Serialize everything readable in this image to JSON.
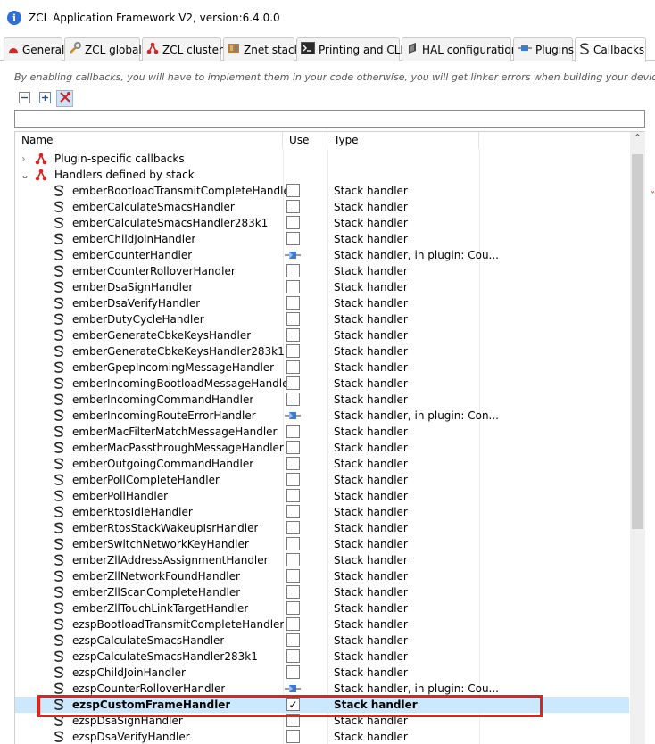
{
  "window": {
    "title": "ZCL Application Framework V2, version:6.4.0.0"
  },
  "tabs": [
    {
      "label": "General",
      "icon": "red-half-circle-icon"
    },
    {
      "label": "ZCL global",
      "icon": "wrench-icon"
    },
    {
      "label": "ZCL clusters",
      "icon": "cluster-nodes-icon"
    },
    {
      "label": "Znet stack",
      "icon": "stack-chip-icon"
    },
    {
      "label": "Printing and CLI",
      "icon": "terminal-icon"
    },
    {
      "label": "HAL configuration",
      "icon": "chip-icon"
    },
    {
      "label": "Plugins",
      "icon": "plugin-icon"
    },
    {
      "label": "Callbacks",
      "icon": "callback-icon",
      "active": true
    }
  ],
  "hint": "By enabling callbacks, you will have to implement them in your code otherwise, you will get linker errors when building your device.",
  "toolbar": {
    "collapse": "collapse-all-icon",
    "expand": "expand-all-icon",
    "filter": "filter-toggle-icon"
  },
  "filter": {
    "value": ""
  },
  "columns": {
    "name": "Name",
    "use": "Use",
    "type": "Type"
  },
  "groups": [
    {
      "label": "Plugin-specific callbacks",
      "expanded": false
    },
    {
      "label": "Handlers defined by stack",
      "expanded": true
    }
  ],
  "rows": [
    {
      "name": "emberBootloadTransmitCompleteHandler",
      "use": "checkbox",
      "checked": false,
      "type": "Stack handler"
    },
    {
      "name": "emberCalculateSmacsHandler",
      "use": "checkbox",
      "checked": false,
      "type": "Stack handler"
    },
    {
      "name": "emberCalculateSmacsHandler283k1",
      "use": "checkbox",
      "checked": false,
      "type": "Stack handler"
    },
    {
      "name": "emberChildJoinHandler",
      "use": "checkbox",
      "checked": false,
      "type": "Stack handler"
    },
    {
      "name": "emberCounterHandler",
      "use": "plugin",
      "checked": false,
      "type": "Stack handler, in plugin: Cou..."
    },
    {
      "name": "emberCounterRolloverHandler",
      "use": "checkbox",
      "checked": false,
      "type": "Stack handler"
    },
    {
      "name": "emberDsaSignHandler",
      "use": "checkbox",
      "checked": false,
      "type": "Stack handler"
    },
    {
      "name": "emberDsaVerifyHandler",
      "use": "checkbox",
      "checked": false,
      "type": "Stack handler"
    },
    {
      "name": "emberDutyCycleHandler",
      "use": "checkbox",
      "checked": false,
      "type": "Stack handler"
    },
    {
      "name": "emberGenerateCbkeKeysHandler",
      "use": "checkbox",
      "checked": false,
      "type": "Stack handler"
    },
    {
      "name": "emberGenerateCbkeKeysHandler283k1",
      "use": "checkbox",
      "checked": false,
      "type": "Stack handler"
    },
    {
      "name": "emberGpepIncomingMessageHandler",
      "use": "checkbox",
      "checked": false,
      "type": "Stack handler"
    },
    {
      "name": "emberIncomingBootloadMessageHandler",
      "use": "checkbox",
      "checked": false,
      "type": "Stack handler"
    },
    {
      "name": "emberIncomingCommandHandler",
      "use": "checkbox",
      "checked": false,
      "type": "Stack handler"
    },
    {
      "name": "emberIncomingRouteErrorHandler",
      "use": "plugin",
      "checked": false,
      "type": "Stack handler, in plugin: Con..."
    },
    {
      "name": "emberMacFilterMatchMessageHandler",
      "use": "checkbox",
      "checked": false,
      "type": "Stack handler"
    },
    {
      "name": "emberMacPassthroughMessageHandler",
      "use": "checkbox",
      "checked": false,
      "type": "Stack handler"
    },
    {
      "name": "emberOutgoingCommandHandler",
      "use": "checkbox",
      "checked": false,
      "type": "Stack handler"
    },
    {
      "name": "emberPollCompleteHandler",
      "use": "checkbox",
      "checked": false,
      "type": "Stack handler"
    },
    {
      "name": "emberPollHandler",
      "use": "checkbox",
      "checked": false,
      "type": "Stack handler"
    },
    {
      "name": "emberRtosIdleHandler",
      "use": "checkbox",
      "checked": false,
      "type": "Stack handler"
    },
    {
      "name": "emberRtosStackWakeupIsrHandler",
      "use": "checkbox",
      "checked": false,
      "type": "Stack handler"
    },
    {
      "name": "emberSwitchNetworkKeyHandler",
      "use": "checkbox",
      "checked": false,
      "type": "Stack handler"
    },
    {
      "name": "emberZllAddressAssignmentHandler",
      "use": "checkbox",
      "checked": false,
      "type": "Stack handler"
    },
    {
      "name": "emberZllNetworkFoundHandler",
      "use": "checkbox",
      "checked": false,
      "type": "Stack handler"
    },
    {
      "name": "emberZllScanCompleteHandler",
      "use": "checkbox",
      "checked": false,
      "type": "Stack handler"
    },
    {
      "name": "emberZllTouchLinkTargetHandler",
      "use": "checkbox",
      "checked": false,
      "type": "Stack handler"
    },
    {
      "name": "ezspBootloadTransmitCompleteHandler",
      "use": "checkbox",
      "checked": false,
      "type": "Stack handler"
    },
    {
      "name": "ezspCalculateSmacsHandler",
      "use": "checkbox",
      "checked": false,
      "type": "Stack handler"
    },
    {
      "name": "ezspCalculateSmacsHandler283k1",
      "use": "checkbox",
      "checked": false,
      "type": "Stack handler"
    },
    {
      "name": "ezspChildJoinHandler",
      "use": "checkbox",
      "checked": false,
      "type": "Stack handler"
    },
    {
      "name": "ezspCounterRolloverHandler",
      "use": "plugin",
      "checked": false,
      "type": "Stack handler, in plugin: Cou..."
    },
    {
      "name": "ezspCustomFrameHandler",
      "use": "checkbox",
      "checked": true,
      "selected": true,
      "type": "Stack handler"
    },
    {
      "name": "ezspDsaSignHandler",
      "use": "checkbox",
      "checked": false,
      "type": "Stack handler"
    },
    {
      "name": "ezspDsaVerifyHandler",
      "use": "checkbox",
      "checked": false,
      "type": "Stack handler"
    }
  ],
  "colors": {
    "selection": "#cce8ff",
    "highlight_box": "#e2231a",
    "plugin_icon": "#3a7bd5"
  }
}
